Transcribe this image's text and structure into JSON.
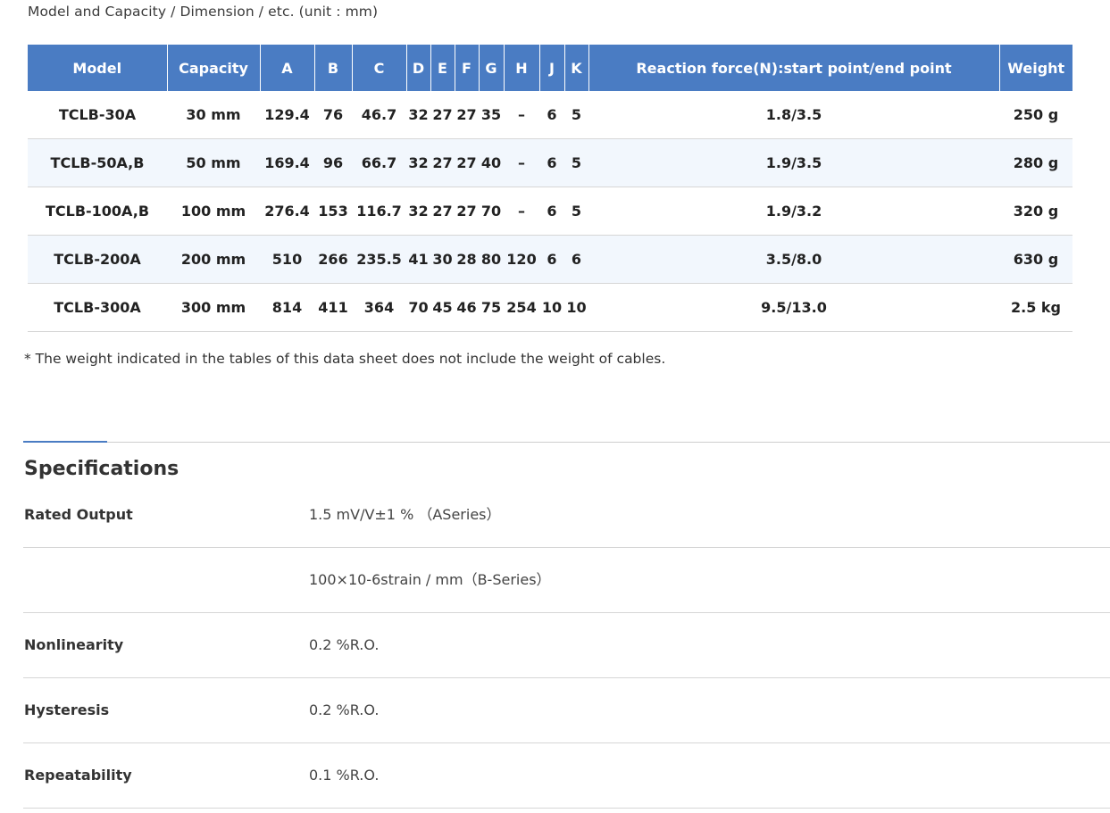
{
  "caption": "Model and Capacity / Dimension / etc. (unit : mm)",
  "table": {
    "headers": [
      "Model",
      "Capacity",
      "A",
      "B",
      "C",
      "D",
      "E",
      "F",
      "G",
      "H",
      "J",
      "K",
      "Reaction force(N):start point/end point",
      "Weight"
    ],
    "rows": [
      [
        "TCLB-30A",
        "30 mm",
        "129.4",
        "76",
        "46.7",
        "32",
        "27",
        "27",
        "35",
        "–",
        "6",
        "5",
        "1.8/3.5",
        "250 g"
      ],
      [
        "TCLB-50A,B",
        "50 mm",
        "169.4",
        "96",
        "66.7",
        "32",
        "27",
        "27",
        "40",
        "–",
        "6",
        "5",
        "1.9/3.5",
        "280 g"
      ],
      [
        "TCLB-100A,B",
        "100 mm",
        "276.4",
        "153",
        "116.7",
        "32",
        "27",
        "27",
        "70",
        "–",
        "6",
        "5",
        "1.9/3.2",
        "320 g"
      ],
      [
        "TCLB-200A",
        "200 mm",
        "510",
        "266",
        "235.5",
        "41",
        "30",
        "28",
        "80",
        "120",
        "6",
        "6",
        "3.5/8.0",
        "630 g"
      ],
      [
        "TCLB-300A",
        "300 mm",
        "814",
        "411",
        "364",
        "70",
        "45",
        "46",
        "75",
        "254",
        "10",
        "10",
        "9.5/13.0",
        "2.5 kg"
      ]
    ]
  },
  "note": "* The weight indicated in the tables of this data sheet does not include the weight of cables.",
  "specifications": {
    "title": "Specifications",
    "rows": [
      {
        "label": "Rated Output",
        "value": "1.5 mV/V±1 % （ASeries）"
      },
      {
        "label": "",
        "value": "100×10-6strain / mm（B-Series）"
      },
      {
        "label": "Nonlinearity",
        "value": "0.2 %R.O."
      },
      {
        "label": "Hysteresis",
        "value": "0.2 %R.O."
      },
      {
        "label": "Repeatability",
        "value": "0.1 %R.O."
      }
    ]
  },
  "colors": {
    "header_bg": "#4a7cc3",
    "row_alt_bg": "#f2f7fd"
  }
}
